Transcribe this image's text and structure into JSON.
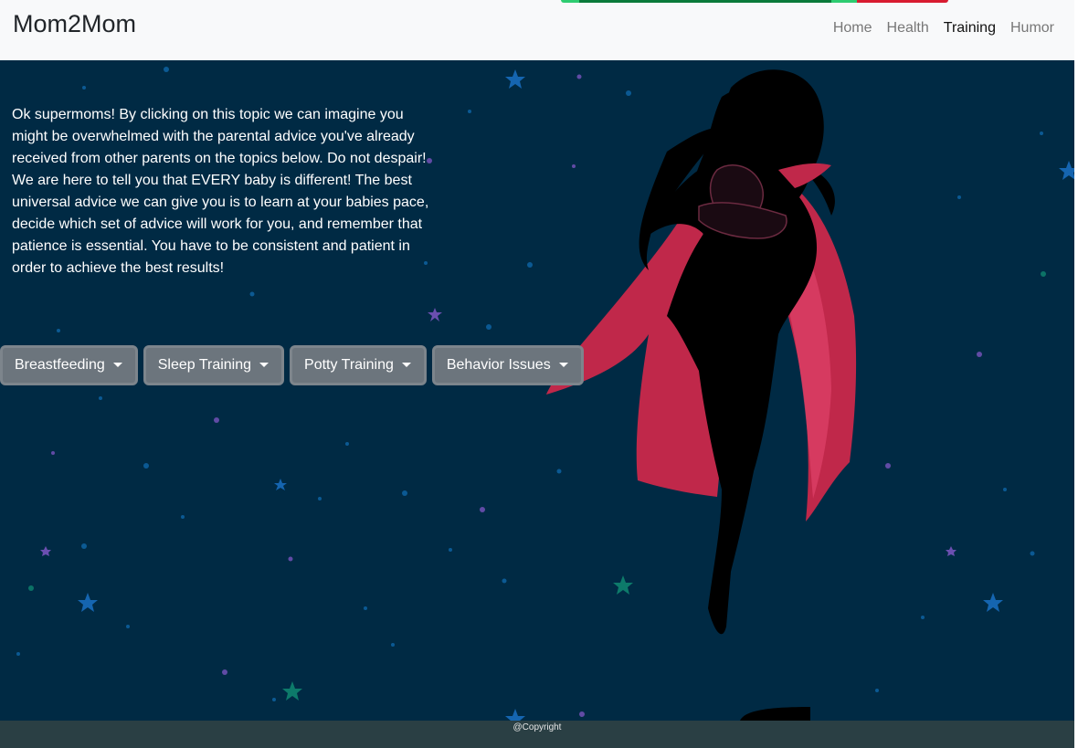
{
  "brand": "Mom2Mom",
  "nav": [
    {
      "label": "Home",
      "active": false
    },
    {
      "label": "Health",
      "active": false
    },
    {
      "label": "Training",
      "active": true
    },
    {
      "label": "Humor",
      "active": false
    }
  ],
  "intro_text": "Ok supermoms! By clicking on this topic we can imagine you might be overwhelmed with the parental advice you've already received from other parents on the topics below. Do not despair! We are here to tell you that EVERY baby is different! The best universal advice we can give you is to learn at your babies pace, decide which set of advice will work for you, and remember that patience is essential. You have to be consistent and patient in order to achieve the best results!",
  "dropdowns": [
    "Breastfeeding",
    "Sleep Training",
    "Potty Training",
    "Behavior Issues"
  ],
  "footer": "@Copyright",
  "colors": {
    "background": "#002a44",
    "navbar": "#f8f9fa",
    "button": "#6c757d",
    "cape": "#c0284a",
    "footer": "#2a3f44"
  },
  "icons": [
    "caret-down-icon",
    "star-icon",
    "supermom-illustration"
  ]
}
